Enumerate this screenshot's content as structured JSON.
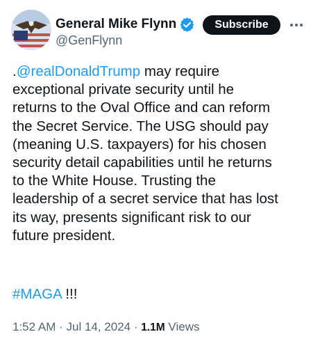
{
  "author": {
    "display_name": "General Mike Flynn",
    "handle": "@GenFlynn",
    "verified_icon": "verified-badge-icon",
    "avatar_icon": "eagle-flag-avatar"
  },
  "header": {
    "subscribe_label": "Subscribe",
    "more_icon": "more-options-icon"
  },
  "tweet": {
    "lead_dot": ".",
    "mention": "@realDonaldTrump",
    "text_lines": [
      " may require",
      "exceptional private security until he",
      "returns to the Oval Office and can reform",
      "the Secret Service. The USG should pay",
      "(meaning U.S. taxpayers) for his chosen",
      "security detail capabilities until he returns",
      "to the White House. Trusting the",
      "leadership of a secret service that has lost",
      "its way, presents significant risk to our",
      "future president."
    ],
    "hashtag": "#MAGA",
    "hashtag_suffix": " !!!"
  },
  "meta": {
    "time": "1:52 AM",
    "separator": " · ",
    "date": "Jul 14, 2024",
    "views_count": "1.1M",
    "views_label": " Views"
  },
  "colors": {
    "link": "#1d9bf0",
    "text": "#0f1419",
    "secondary": "#536471",
    "verified": "#1d9bf0"
  }
}
